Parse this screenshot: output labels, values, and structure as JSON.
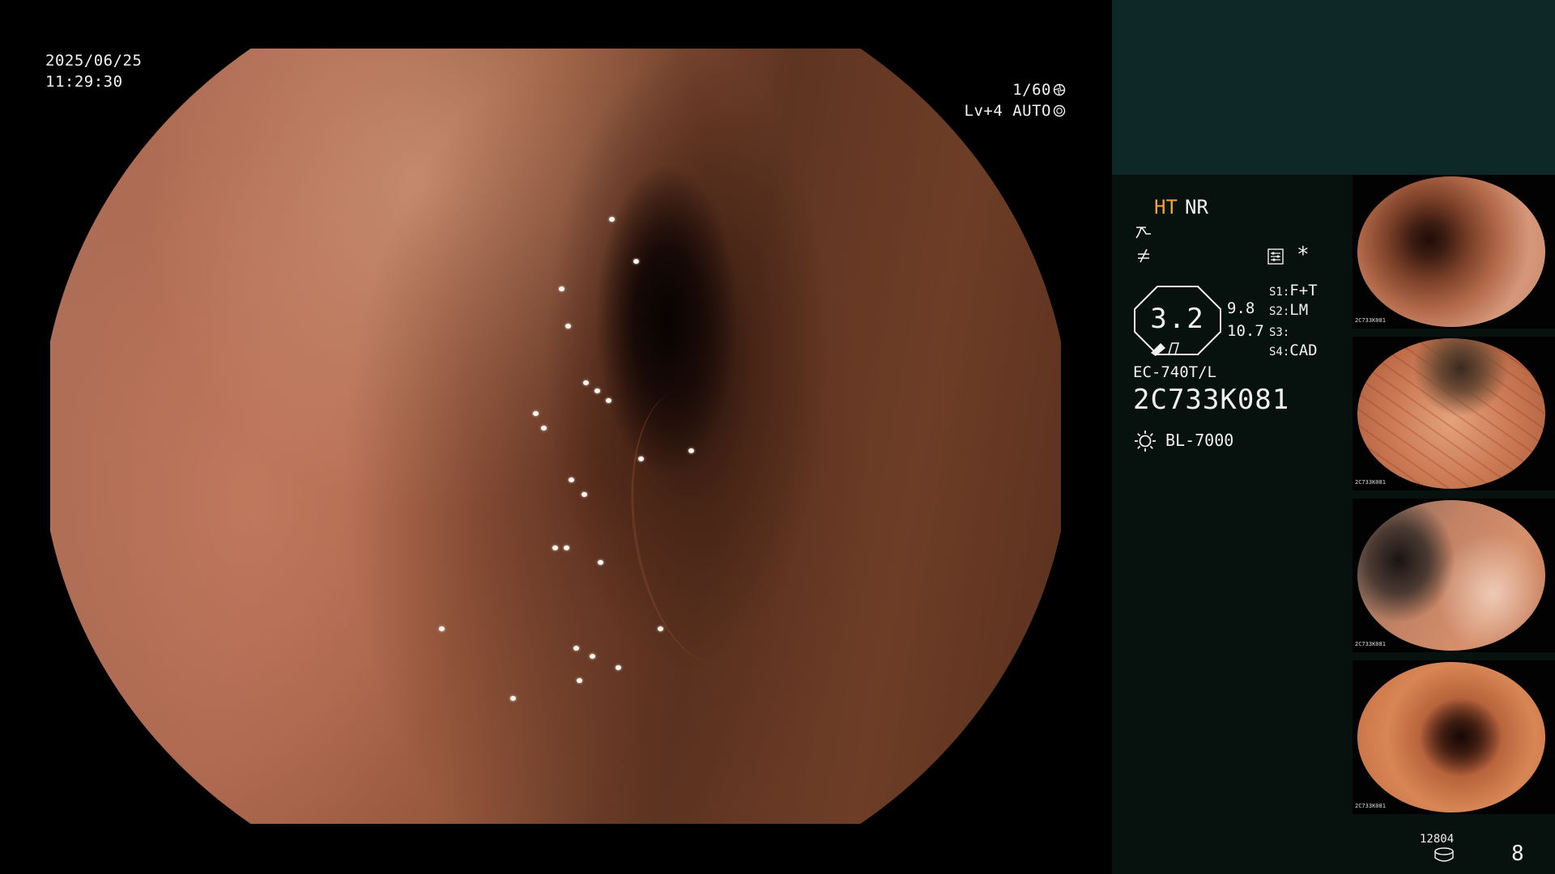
{
  "overlay": {
    "date": "2025/06/25",
    "time": "11:29:30",
    "shutter": "1/60",
    "level": "Lv+4",
    "iris_mode": "AUTO"
  },
  "panel": {
    "mode_ht": "HT",
    "mode_nr": "NR",
    "asterisk": "*",
    "zoom": "3.2",
    "zoom_reading_a": "9.8",
    "zoom_reading_b": "10.7",
    "settings": [
      {
        "key": "S1",
        "value": "F+T"
      },
      {
        "key": "S2",
        "value": "LM"
      },
      {
        "key": "S3",
        "value": ""
      },
      {
        "key": "S4",
        "value": "CAD"
      }
    ],
    "scope_model": "EC-740T/L",
    "scope_serial": "2C733K081",
    "light_source": "BL-7000",
    "frame_counter": "12804",
    "page_number": "8",
    "accent_color": "#f3a53a",
    "panel_color": "#0d2826"
  },
  "thumbnails": [
    {
      "label": "2C733K081"
    },
    {
      "label": "2C733K081"
    },
    {
      "label": "2C733K081"
    },
    {
      "label": "2C733K081"
    }
  ],
  "icons": {
    "shutter": "shutter-icon",
    "iris": "iris-icon",
    "enhance": "enhance-icon",
    "not_equal": "not-equal-icon",
    "settings": "settings-icon",
    "light": "light-source-icon",
    "storage": "storage-icon"
  }
}
